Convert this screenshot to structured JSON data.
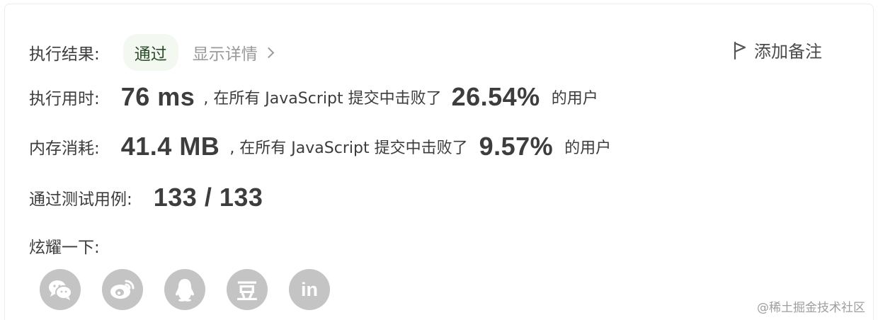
{
  "result": {
    "label": "执行结果:",
    "status": "通过",
    "details_link": "显示详情",
    "add_note": "添加备注"
  },
  "runtime": {
    "label": "执行用时:",
    "value": "76 ms",
    "text_mid": ", 在所有 JavaScript 提交中击败了",
    "percent": "26.54%",
    "text_end": "的用户"
  },
  "memory": {
    "label": "内存消耗:",
    "value": "41.4 MB",
    "text_mid": ", 在所有 JavaScript 提交中击败了",
    "percent": "9.57%",
    "text_end": "的用户"
  },
  "testcases": {
    "label": "通过测试用例:",
    "value": "133 / 133"
  },
  "share": {
    "label": "炫耀一下:",
    "icons": [
      "wechat-icon",
      "weibo-icon",
      "qq-icon",
      "douban-icon",
      "linkedin-icon"
    ],
    "douban_glyph": "豆",
    "linkedin_glyph": "in"
  },
  "watermark": "@稀土掘金技术社区",
  "colors": {
    "status_badge_bg": "#f3f8f1",
    "icon_bg": "#c4c4c4"
  }
}
